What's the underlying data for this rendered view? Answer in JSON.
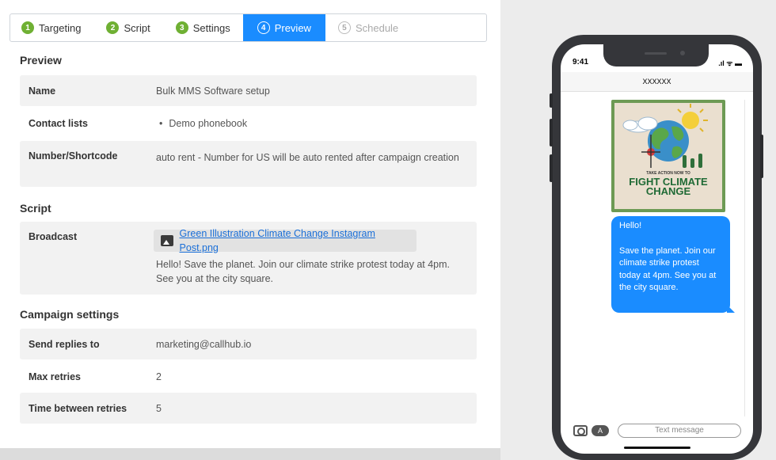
{
  "steps": [
    {
      "num": "1",
      "label": "Targeting"
    },
    {
      "num": "2",
      "label": "Script"
    },
    {
      "num": "3",
      "label": "Settings"
    },
    {
      "num": "4",
      "label": "Preview"
    },
    {
      "num": "5",
      "label": "Schedule"
    }
  ],
  "preview": {
    "title": "Preview",
    "name_label": "Name",
    "name_value": "Bulk MMS Software setup",
    "contacts_label": "Contact lists",
    "contacts_value": "Demo phonebook",
    "number_label": "Number/Shortcode",
    "number_value": "auto rent - Number for US will be auto rented after campaign creation"
  },
  "script": {
    "title": "Script",
    "broadcast_label": "Broadcast",
    "attachment": "Green Illustration Climate Change Instagram Post.png",
    "message_line1": "Hello! Save the planet. Join our climate strike protest today at 4pm.",
    "message_line2": "See you at the city square."
  },
  "settings": {
    "title": "Campaign settings",
    "replies_label": "Send replies to",
    "replies_value": "marketing@callhub.io",
    "retries_label": "Max retries",
    "retries_value": "2",
    "between_label": "Time between retries",
    "between_value": "5"
  },
  "phone": {
    "time": "9:41",
    "status": ".ıl ᯤ ▬",
    "contact": "XXXXXX",
    "image_take": "TAKE ACTION NOW TO",
    "image_fight": "FIGHT CLIMATE CHANGE",
    "bubble_line1": "Hello!",
    "bubble_line2": "Save the planet. Join our climate strike protest today at 4pm. See you at the city square.",
    "composer_placeholder": "Text message",
    "app_icon_glyph": "A"
  },
  "colors": {
    "accent": "#1a8cff",
    "step_done": "#6fb033",
    "poster_green": "#1f6a35"
  }
}
